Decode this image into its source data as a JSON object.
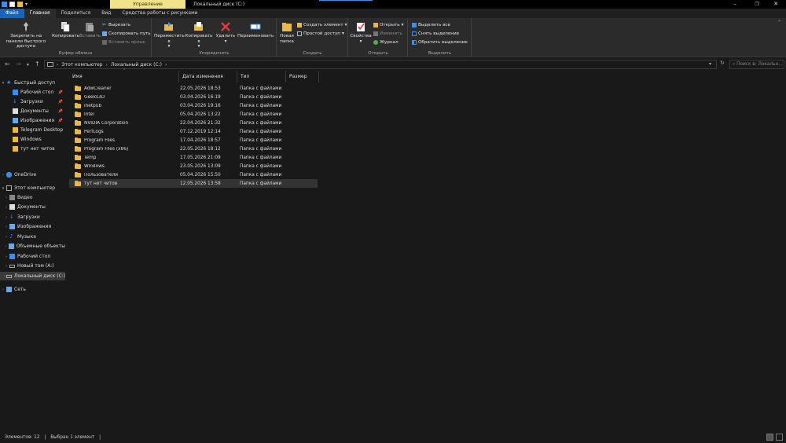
{
  "titlebar": {
    "context_tab": "Управление",
    "window_title": "Локальный диск (C:)",
    "minimize": "–",
    "maximize": "❐",
    "close": "✕"
  },
  "tabs": [
    "Файл",
    "Главная",
    "Поделиться",
    "Вид",
    "Средства работы с рисунками"
  ],
  "ribbon": {
    "clipboard": {
      "label": "Буфер обмена",
      "pin_label": "Закрепить на панели быстрого доступа",
      "copy_label": "Копировать",
      "paste_label": "Вставить",
      "cut": "Вырезать",
      "copy_path": "Скопировать путь",
      "paste_shortcut": "Вставить ярлык"
    },
    "organize": {
      "label": "Упорядочить",
      "move_to": "Переместить в",
      "copy_to": "Копировать в",
      "delete": "Удалить",
      "rename": "Переименовать"
    },
    "create": {
      "label": "Создать",
      "new_folder": "Новая папка",
      "new_item": "Создать элемент",
      "easy_access": "Простой доступ"
    },
    "open": {
      "label": "Открыть",
      "properties": "Свойства",
      "open": "Открыть",
      "edit": "Изменить",
      "history": "Журнал"
    },
    "select": {
      "label": "Выделить",
      "select_all": "Выделить все",
      "select_none": "Снять выделение",
      "invert": "Обратить выделение"
    }
  },
  "address": {
    "crumbs": [
      "Этот компьютер",
      "Локальный диск (C:)"
    ],
    "search_placeholder": "Поиск в: Локальн..."
  },
  "nav": {
    "quick_access": "Быстрый доступ",
    "quick_items": [
      "Рабочий стол",
      "Загрузки",
      "Документы",
      "Изображения",
      "Telegram Desktop",
      "Windows",
      "тут нет читов"
    ],
    "onedrive": "OneDrive",
    "this_pc": "Этот компьютер",
    "pc_items": [
      "Видео",
      "Документы",
      "Загрузки",
      "Изображения",
      "Музыка",
      "Объемные объекты",
      "Рабочий стол",
      "Новый том (A:)",
      "Локальный диск (C:)"
    ],
    "network": "Сеть"
  },
  "columns": {
    "name": "Имя",
    "date": "Дата изменения",
    "type": "Тип",
    "size": "Размер"
  },
  "files": [
    {
      "name": "AdwCleaner",
      "date": "22.05.2026 18:53",
      "type": "Папка с файлами"
    },
    {
      "name": "Geeks3D",
      "date": "03.04.2026 16:19",
      "type": "Папка с файлами"
    },
    {
      "name": "inetpub",
      "date": "03.04.2026 19:16",
      "type": "Папка с файлами"
    },
    {
      "name": "Intel",
      "date": "05.04.2026 13:22",
      "type": "Папка с файлами"
    },
    {
      "name": "NVIDIA Corporation",
      "date": "22.04.2026 21:32",
      "type": "Папка с файлами"
    },
    {
      "name": "PerfLogs",
      "date": "07.12.2019 12:14",
      "type": "Папка с файлами"
    },
    {
      "name": "Program Files",
      "date": "17.04.2026 18:57",
      "type": "Папка с файлами"
    },
    {
      "name": "Program Files (x86)",
      "date": "22.05.2026 18:12",
      "type": "Папка с файлами"
    },
    {
      "name": "Temp",
      "date": "17.05.2026 21:09",
      "type": "Папка с файлами"
    },
    {
      "name": "Windows",
      "date": "23.05.2026 13:09",
      "type": "Папка с файлами"
    },
    {
      "name": "Пользователи",
      "date": "05.04.2026 15:50",
      "type": "Папка с файлами"
    },
    {
      "name": "тут нет читов",
      "date": "12.05.2026 13:58",
      "type": "Папка с файлами"
    }
  ],
  "status": {
    "count": "Элементов: 12",
    "selected": "Выбран 1 элемент"
  },
  "colors": {
    "file_tab": "#1a64b8",
    "context_tab": "#f1e38a",
    "folder": "#e8b94a",
    "delete_red": "#e03a3a"
  }
}
